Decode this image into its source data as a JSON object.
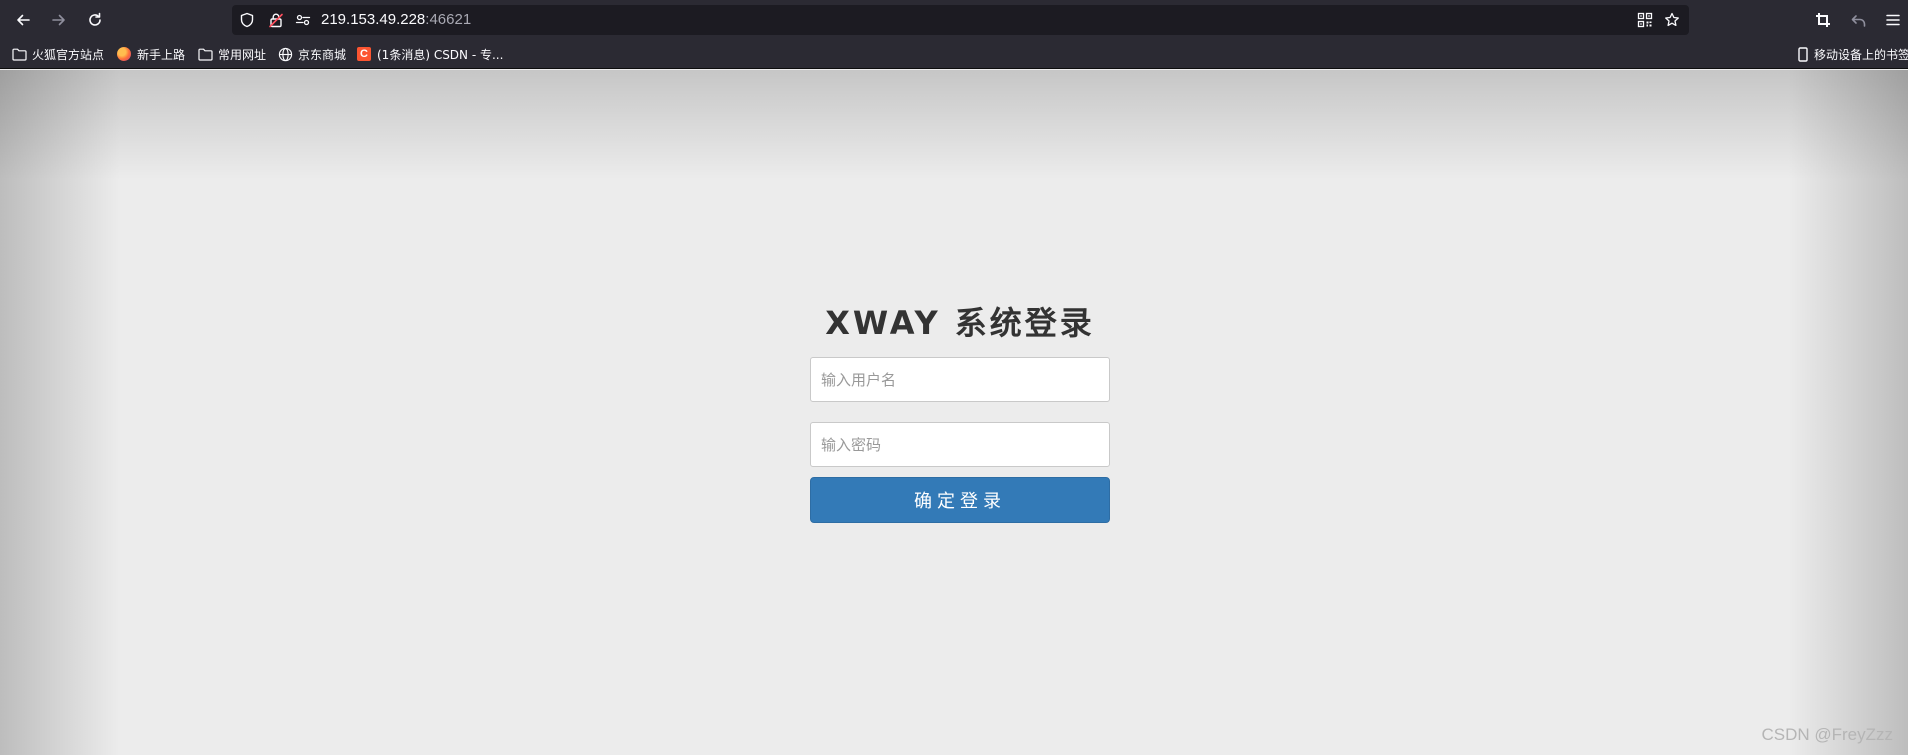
{
  "browser": {
    "url_host": "219.153.49.228",
    "url_port": ":46621",
    "bookmarks": [
      {
        "label": "火狐官方站点",
        "icon": "folder-icon"
      },
      {
        "label": "新手上路",
        "icon": "firefox-icon"
      },
      {
        "label": "常用网址",
        "icon": "folder-icon"
      },
      {
        "label": "京东商城",
        "icon": "globe-icon"
      },
      {
        "label": "(1条消息) CSDN - 专...",
        "icon": "csdn-icon",
        "icon_text": "C"
      }
    ],
    "mobile_bookmarks": "移动设备上的书签"
  },
  "login": {
    "title": "XWAY 系统登录",
    "username_placeholder": "输入用户名",
    "password_placeholder": "输入密码",
    "submit_label": "确定登录"
  },
  "watermark": "CSDN @FreyZzz",
  "colors": {
    "chrome_bg": "#2b2a33",
    "urlbar_bg": "#1c1b22",
    "page_bg": "#ececec",
    "button_primary": "#337ab7",
    "csdn_brand": "#fc5531"
  }
}
